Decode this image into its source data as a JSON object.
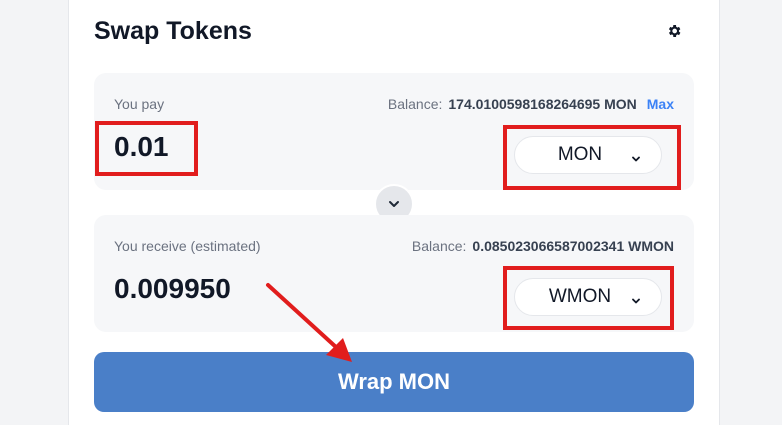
{
  "swap": {
    "title": "Swap Tokens",
    "settings_icon": "gear-icon",
    "pay": {
      "label": "You pay",
      "balance_label": "Balance:",
      "balance_value": "174.0100598168264695 MON",
      "max_label": "Max",
      "amount": "0.01",
      "token": "MON"
    },
    "receive": {
      "label": "You receive (estimated)",
      "balance_label": "Balance:",
      "balance_value": "0.085023066587002341 WMON",
      "amount": "0.009950",
      "token": "WMON"
    },
    "switch_icon": "chevron-down-icon",
    "action_label": "Wrap MON"
  },
  "colors": {
    "accent": "#4a7fc8",
    "highlight": "#e11d1d",
    "link": "#3b82f6"
  }
}
